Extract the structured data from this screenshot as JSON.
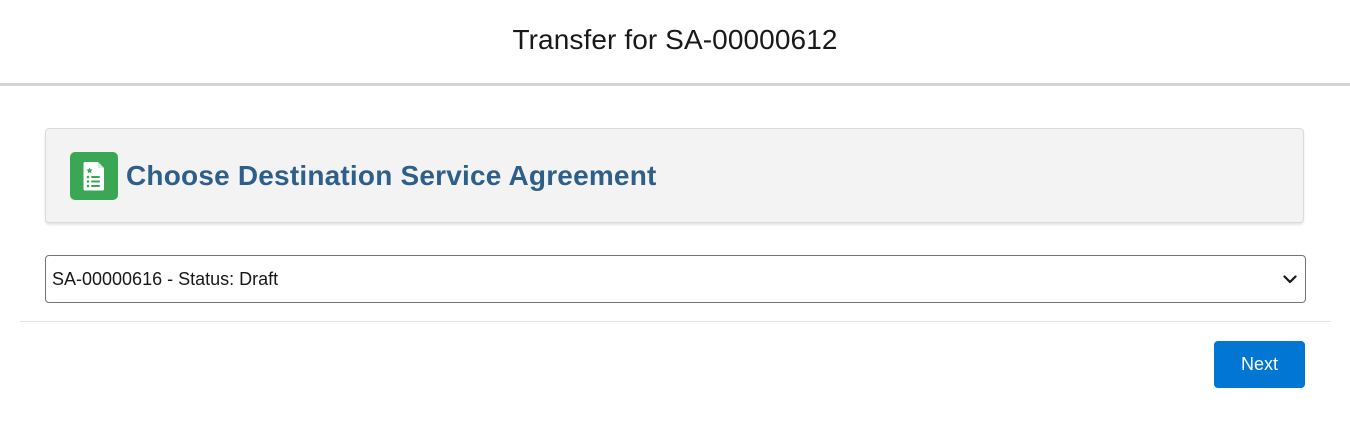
{
  "modal": {
    "title": "Transfer for SA-00000612"
  },
  "card": {
    "icon": "document-list-icon",
    "title": "Choose Destination Service Agreement"
  },
  "destination_select": {
    "selected_value": "SA-00000616 - Status: Draft",
    "icon": "chevron-down-icon"
  },
  "footer": {
    "next_label": "Next"
  },
  "colors": {
    "accent": "#0176d3",
    "card_title": "#2e5f8a",
    "icon_bg": "#3ba755",
    "card_bg": "#f3f3f3"
  }
}
